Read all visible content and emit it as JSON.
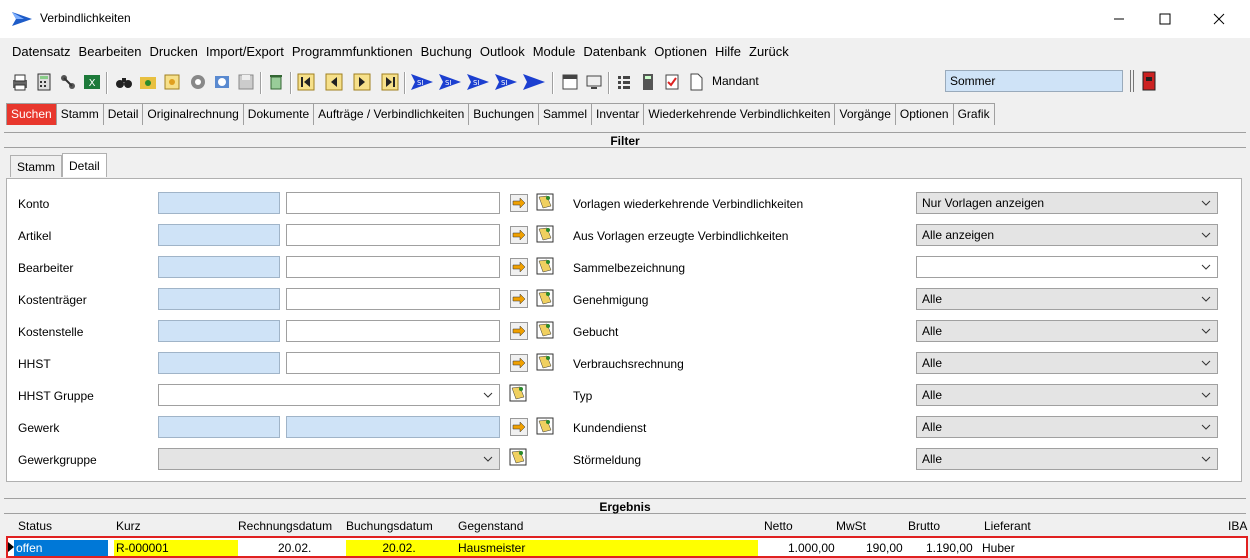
{
  "window": {
    "title": "Verbindlichkeiten"
  },
  "menu": [
    "Datensatz",
    "Bearbeiten",
    "Drucken",
    "Import/Export",
    "Programmfunktionen",
    "Buchung",
    "Outlook",
    "Module",
    "Datenbank",
    "Optionen",
    "Hilfe",
    "Zurück"
  ],
  "toolbar": {
    "mandant_label": "Mandant",
    "mandant_value": "Sommer"
  },
  "tabs": [
    "Suchen",
    "Stamm",
    "Detail",
    "Originalrechnung",
    "Dokumente",
    "Aufträge / Verbindlichkeiten",
    "Buchungen",
    "Sammel",
    "Inventar",
    "Wiederkehrende Verbindlichkeiten",
    "Vorgänge",
    "Optionen",
    "Grafik"
  ],
  "filter": {
    "title": "Filter",
    "subtabs": [
      "Stamm",
      "Detail"
    ],
    "left": {
      "konto": "Konto",
      "artikel": "Artikel",
      "bearbeiter": "Bearbeiter",
      "kostentraeger": "Kostenträger",
      "kostenstelle": "Kostenstelle",
      "hhst": "HHST",
      "hhst_gruppe": "HHST Gruppe",
      "gewerk": "Gewerk",
      "gewerkgruppe": "Gewerkgruppe"
    },
    "right": {
      "vorlagen": {
        "label": "Vorlagen wiederkehrende Verbindlichkeiten",
        "value": "Nur Vorlagen anzeigen"
      },
      "aus_vorlagen": {
        "label": "Aus Vorlagen erzeugte Verbindlichkeiten",
        "value": "Alle anzeigen"
      },
      "sammel": {
        "label": "Sammelbezeichnung",
        "value": ""
      },
      "genehmigung": {
        "label": "Genehmigung",
        "value": "Alle"
      },
      "gebucht": {
        "label": "Gebucht",
        "value": "Alle"
      },
      "verbrauch": {
        "label": "Verbrauchsrechnung",
        "value": "Alle"
      },
      "typ": {
        "label": "Typ",
        "value": "Alle"
      },
      "kundendienst": {
        "label": "Kundendienst",
        "value": "Alle"
      },
      "stoermeldung": {
        "label": "Störmeldung",
        "value": "Alle"
      }
    }
  },
  "result": {
    "title": "Ergebnis",
    "columns": [
      "Status",
      "Kurz",
      "Rechnungsdatum",
      "Buchungsdatum",
      "Gegenstand",
      "Netto",
      "MwSt",
      "Brutto",
      "Lieferant",
      "IBA"
    ],
    "row": {
      "status": "offen",
      "kurz": "R-000001",
      "rechnungsdatum": "20.02.",
      "buchungsdatum": "20.02.",
      "gegenstand": "Hausmeister",
      "netto": "1.000,00",
      "mwst": "190,00",
      "brutto": "1.190,00",
      "lieferant": "Huber"
    }
  },
  "colors": {
    "active_tab": "#e8372d",
    "field_blue": "#cfe3f7",
    "highlight_yellow": "#ffff00",
    "selection_blue": "#0078d7",
    "row_border": "#e02020"
  }
}
